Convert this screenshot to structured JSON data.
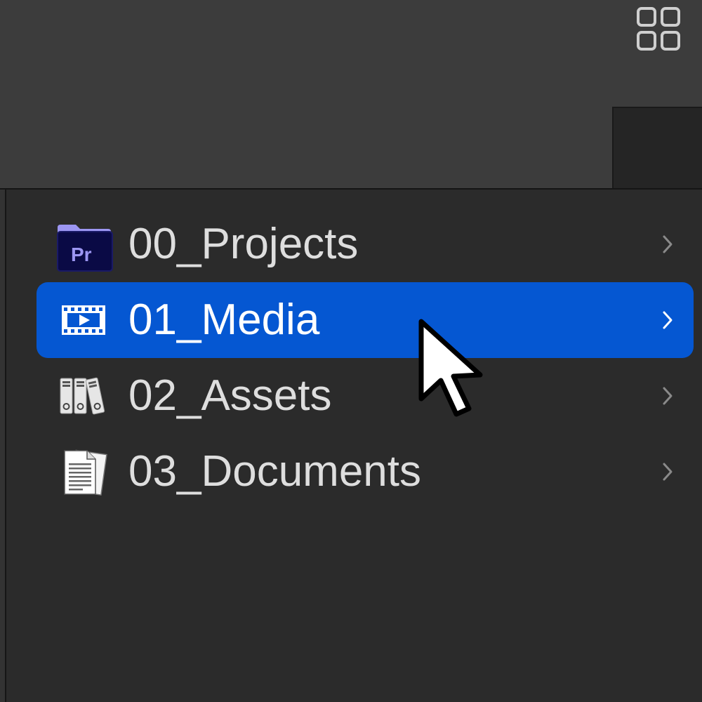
{
  "toolbar": {
    "view_icon": "grid-view-icon"
  },
  "folders": [
    {
      "label": "00_Projects",
      "icon": "premiere-pro-folder-icon",
      "icon_text": "Pr",
      "selected": false
    },
    {
      "label": "01_Media",
      "icon": "film-strip-icon",
      "selected": true
    },
    {
      "label": "02_Assets",
      "icon": "binders-icon",
      "selected": false
    },
    {
      "label": "03_Documents",
      "icon": "documents-icon",
      "selected": false
    }
  ],
  "colors": {
    "selection": "#0557d2",
    "background": "#2b2b2b",
    "toolbar_background": "#3c3c3c",
    "text": "#dedede"
  },
  "cursor": {
    "icon": "arrow-cursor-icon"
  }
}
